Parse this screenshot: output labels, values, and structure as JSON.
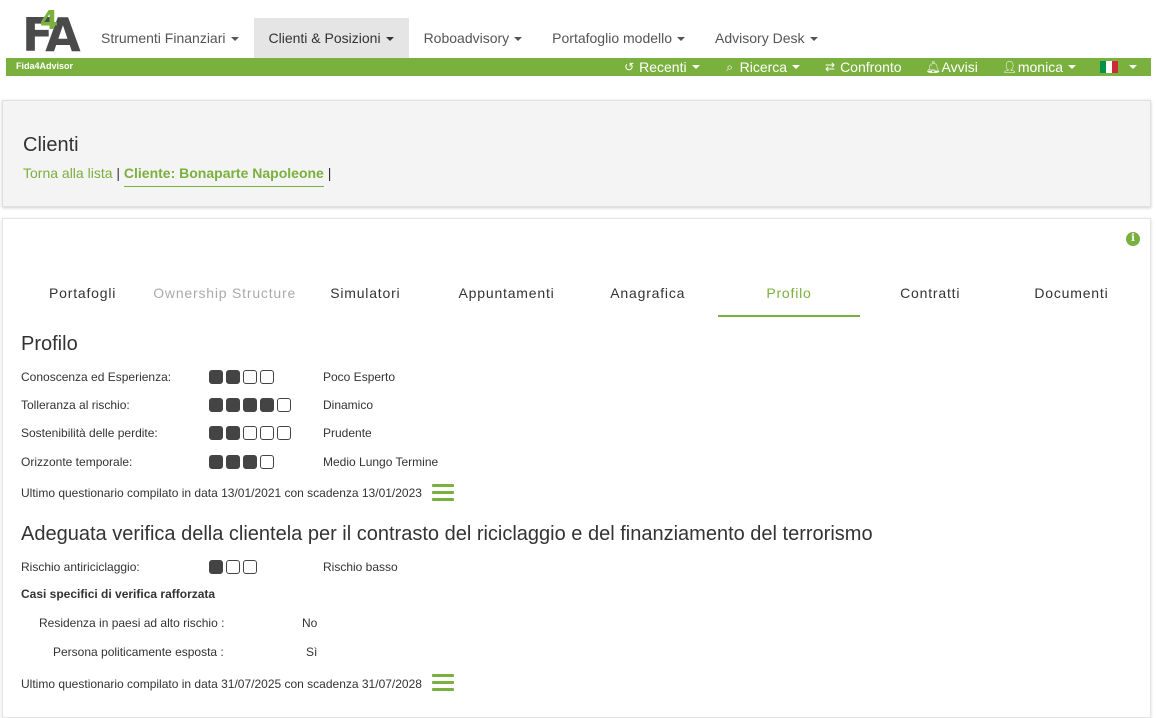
{
  "brand": {
    "logo": "FA",
    "logo_accent": "4",
    "subtitle": "Fida4Advisor"
  },
  "topnav": [
    {
      "label": "Strumenti Finanziari",
      "active": false
    },
    {
      "label": "Clienti & Posizioni",
      "active": true
    },
    {
      "label": "Roboadvisory",
      "active": false
    },
    {
      "label": "Portafoglio modello",
      "active": false
    },
    {
      "label": "Advisory Desk",
      "active": false
    }
  ],
  "greenmenu": {
    "recenti": "Recenti",
    "ricerca": "Ricerca",
    "confronto": "Confronto",
    "avvisi": "Avvisi",
    "user": "monica"
  },
  "clients_panel": {
    "title": "Clienti",
    "back_link": "Torna alla lista",
    "separator": "|",
    "client": "Cliente: Bonaparte Napoleone"
  },
  "tabs": [
    {
      "label": "Portafogli",
      "state": "normal"
    },
    {
      "label": "Ownership Structure",
      "state": "disabled"
    },
    {
      "label": "Simulatori",
      "state": "normal"
    },
    {
      "label": "Appuntamenti",
      "state": "normal"
    },
    {
      "label": "Anagrafica",
      "state": "normal"
    },
    {
      "label": "Profilo",
      "state": "active"
    },
    {
      "label": "Contratti",
      "state": "normal"
    },
    {
      "label": "Documenti",
      "state": "normal"
    }
  ],
  "profilo": {
    "title": "Profilo",
    "rows": [
      {
        "label": "Conoscenza ed Esperienza:",
        "filled": 2,
        "total": 4,
        "value": "Poco Esperto"
      },
      {
        "label": "Tolleranza al rischio:",
        "filled": 4,
        "total": 5,
        "value": "Dinamico"
      },
      {
        "label": "Sostenibilità delle perdite:",
        "filled": 2,
        "total": 5,
        "value": "Prudente"
      },
      {
        "label": "Orizzonte temporale:",
        "filled": 3,
        "total": 4,
        "value": "Medio Lungo Termine"
      }
    ],
    "footer": "Ultimo questionario compilato in data 13/01/2021 con scadenza 13/01/2023"
  },
  "aml": {
    "title": "Adeguata verifica della clientela per il contrasto del riciclaggio e del finanziamento del terrorismo",
    "risk": {
      "label": "Rischio antiriciclaggio:",
      "filled": 1,
      "total": 3,
      "value": "Rischio basso"
    },
    "specific_title": "Casi specifici di verifica rafforzata",
    "cases": [
      {
        "label": "Residenza in paesi ad alto rischio :",
        "value": "No"
      },
      {
        "label": "Persona politicamente esposta :",
        "value": "Sì"
      }
    ],
    "footer": "Ultimo questionario compilato in data 31/07/2025 con scadenza 31/07/2028"
  },
  "colors": {
    "accent": "#7ab03d",
    "nav_active_bg": "#e5e5e5",
    "panel_bg": "#f4f4f4"
  }
}
